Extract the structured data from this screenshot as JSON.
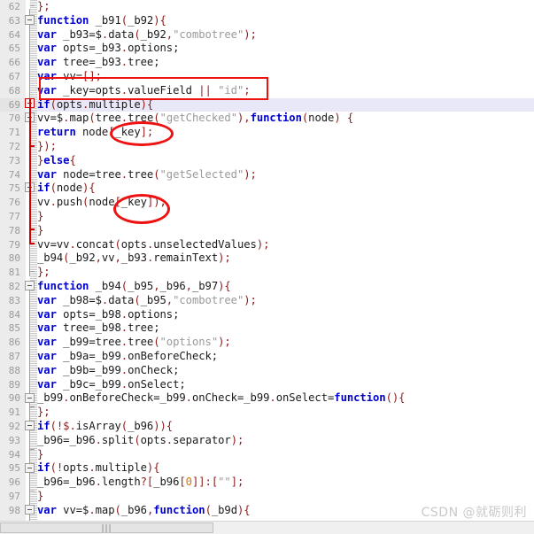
{
  "app": {
    "type": "code-editor",
    "language": "javascript",
    "watermark": "CSDN @就砺则利"
  },
  "colors": {
    "keyword": "#0000d0",
    "string": "#9a9a9a",
    "number": "#e07000",
    "punctuation": "#8b1a1a",
    "plain": "#1a1a1a",
    "gutter_bg": "#ececec",
    "line_number": "#9a9a9a",
    "current_line_bg": "#e8e8f8",
    "annotation": "#ee1111",
    "fold_marker": "#9a9a9a"
  },
  "editor": {
    "first_line_number": 62,
    "last_line_number": 98,
    "current_line": 69,
    "lines": [
      {
        "n": "62",
        "tokens": [
          {
            "t": "  ",
            "c": "plain"
          },
          {
            "t": "};",
            "c": "pun"
          }
        ]
      },
      {
        "n": "63",
        "tokens": [
          {
            "t": "function",
            "c": "kw"
          },
          {
            "t": " _b91",
            "c": "plain"
          },
          {
            "t": "(",
            "c": "pun"
          },
          {
            "t": "_b92",
            "c": "plain"
          },
          {
            "t": "){",
            "c": "pun"
          }
        ]
      },
      {
        "n": "64",
        "tokens": [
          {
            "t": " ",
            "c": "plain"
          },
          {
            "t": "var",
            "c": "kw"
          },
          {
            "t": " _b93=$",
            "c": "plain"
          },
          {
            "t": ".",
            "c": "pun"
          },
          {
            "t": "data",
            "c": "plain"
          },
          {
            "t": "(",
            "c": "pun"
          },
          {
            "t": "_b92",
            "c": "plain"
          },
          {
            "t": ",",
            "c": "pun"
          },
          {
            "t": "\"combotree\"",
            "c": "str"
          },
          {
            "t": ");",
            "c": "pun"
          }
        ]
      },
      {
        "n": "65",
        "tokens": [
          {
            "t": " ",
            "c": "plain"
          },
          {
            "t": "var",
            "c": "kw"
          },
          {
            "t": " opts=_b93",
            "c": "plain"
          },
          {
            "t": ".",
            "c": "pun"
          },
          {
            "t": "options;",
            "c": "plain"
          }
        ]
      },
      {
        "n": "66",
        "tokens": [
          {
            "t": " ",
            "c": "plain"
          },
          {
            "t": "var",
            "c": "kw"
          },
          {
            "t": " tree=_b93",
            "c": "plain"
          },
          {
            "t": ".",
            "c": "pun"
          },
          {
            "t": "tree;",
            "c": "plain"
          }
        ]
      },
      {
        "n": "67",
        "tokens": [
          {
            "t": " ",
            "c": "plain"
          },
          {
            "t": "var",
            "c": "kw"
          },
          {
            "t": " vv=",
            "c": "plain"
          },
          {
            "t": "[];",
            "c": "pun"
          }
        ]
      },
      {
        "n": "68",
        "tokens": [
          {
            "t": " ",
            "c": "plain"
          },
          {
            "t": "var",
            "c": "kw"
          },
          {
            "t": " _key=opts",
            "c": "plain"
          },
          {
            "t": ".",
            "c": "pun"
          },
          {
            "t": "valueField ",
            "c": "plain"
          },
          {
            "t": "||",
            "c": "pun"
          },
          {
            "t": " ",
            "c": "plain"
          },
          {
            "t": "\"id\"",
            "c": "str"
          },
          {
            "t": ";",
            "c": "pun"
          }
        ]
      },
      {
        "n": "69",
        "tokens": [
          {
            "t": "if",
            "c": "kw"
          },
          {
            "t": "(",
            "c": "pun"
          },
          {
            "t": "opts",
            "c": "plain"
          },
          {
            "t": ".",
            "c": "pun"
          },
          {
            "t": "multiple",
            "c": "plain"
          },
          {
            "t": "){",
            "c": "pun"
          }
        ]
      },
      {
        "n": "70",
        "tokens": [
          {
            "t": "vv=$",
            "c": "plain"
          },
          {
            "t": ".",
            "c": "pun"
          },
          {
            "t": "map",
            "c": "plain"
          },
          {
            "t": "(",
            "c": "pun"
          },
          {
            "t": "tree",
            "c": "plain"
          },
          {
            "t": ".",
            "c": "pun"
          },
          {
            "t": "tree",
            "c": "plain"
          },
          {
            "t": "(",
            "c": "pun"
          },
          {
            "t": "\"getChecked\"",
            "c": "str"
          },
          {
            "t": "),",
            "c": "pun"
          },
          {
            "t": "function",
            "c": "kw"
          },
          {
            "t": "(",
            "c": "pun"
          },
          {
            "t": "node",
            "c": "plain"
          },
          {
            "t": ") {",
            "c": "pun"
          }
        ]
      },
      {
        "n": "71",
        "tokens": [
          {
            "t": " ",
            "c": "plain"
          },
          {
            "t": "return",
            "c": "kw"
          },
          {
            "t": " node",
            "c": "plain"
          },
          {
            "t": "[",
            "c": "pun"
          },
          {
            "t": "_key",
            "c": "plain"
          },
          {
            "t": "];",
            "c": "pun"
          }
        ]
      },
      {
        "n": "72",
        "tokens": [
          {
            "t": "});",
            "c": "pun"
          }
        ]
      },
      {
        "n": "73",
        "tokens": [
          {
            "t": " ",
            "c": "plain"
          },
          {
            "t": "}",
            "c": "pun"
          },
          {
            "t": "else",
            "c": "kw"
          },
          {
            "t": "{",
            "c": "pun"
          }
        ]
      },
      {
        "n": "74",
        "tokens": [
          {
            "t": " ",
            "c": "plain"
          },
          {
            "t": "var",
            "c": "kw"
          },
          {
            "t": " node=tree",
            "c": "plain"
          },
          {
            "t": ".",
            "c": "pun"
          },
          {
            "t": "tree",
            "c": "plain"
          },
          {
            "t": "(",
            "c": "pun"
          },
          {
            "t": "\"getSelected\"",
            "c": "str"
          },
          {
            "t": ");",
            "c": "pun"
          }
        ]
      },
      {
        "n": "75",
        "tokens": [
          {
            "t": "if",
            "c": "kw"
          },
          {
            "t": "(",
            "c": "pun"
          },
          {
            "t": "node",
            "c": "plain"
          },
          {
            "t": "){",
            "c": "pun"
          }
        ]
      },
      {
        "n": "76",
        "tokens": [
          {
            "t": "vv",
            "c": "plain"
          },
          {
            "t": ".",
            "c": "pun"
          },
          {
            "t": "push",
            "c": "plain"
          },
          {
            "t": "(",
            "c": "pun"
          },
          {
            "t": "node",
            "c": "plain"
          },
          {
            "t": "[",
            "c": "pun"
          },
          {
            "t": "_key",
            "c": "plain"
          },
          {
            "t": "]);",
            "c": "pun"
          }
        ]
      },
      {
        "n": "77",
        "tokens": [
          {
            "t": "}",
            "c": "pun"
          }
        ]
      },
      {
        "n": "78",
        "tokens": [
          {
            "t": "}",
            "c": "pun"
          }
        ]
      },
      {
        "n": "79",
        "tokens": [
          {
            "t": " vv=vv",
            "c": "plain"
          },
          {
            "t": ".",
            "c": "pun"
          },
          {
            "t": "concat",
            "c": "plain"
          },
          {
            "t": "(",
            "c": "pun"
          },
          {
            "t": "opts",
            "c": "plain"
          },
          {
            "t": ".",
            "c": "pun"
          },
          {
            "t": "unselectedValues",
            "c": "plain"
          },
          {
            "t": ");",
            "c": "pun"
          }
        ]
      },
      {
        "n": "80",
        "tokens": [
          {
            "t": " _b94",
            "c": "plain"
          },
          {
            "t": "(",
            "c": "pun"
          },
          {
            "t": "_b92",
            "c": "plain"
          },
          {
            "t": ",",
            "c": "pun"
          },
          {
            "t": "vv",
            "c": "plain"
          },
          {
            "t": ",",
            "c": "pun"
          },
          {
            "t": "_b93",
            "c": "plain"
          },
          {
            "t": ".",
            "c": "pun"
          },
          {
            "t": "remainText",
            "c": "plain"
          },
          {
            "t": ");",
            "c": "pun"
          }
        ]
      },
      {
        "n": "81",
        "tokens": [
          {
            "t": "};",
            "c": "pun"
          }
        ]
      },
      {
        "n": "82",
        "tokens": [
          {
            "t": "function",
            "c": "kw"
          },
          {
            "t": " _b94",
            "c": "plain"
          },
          {
            "t": "(",
            "c": "pun"
          },
          {
            "t": "_b95",
            "c": "plain"
          },
          {
            "t": ",",
            "c": "pun"
          },
          {
            "t": "_b96",
            "c": "plain"
          },
          {
            "t": ",",
            "c": "pun"
          },
          {
            "t": "_b97",
            "c": "plain"
          },
          {
            "t": "){",
            "c": "pun"
          }
        ]
      },
      {
        "n": "83",
        "tokens": [
          {
            "t": " ",
            "c": "plain"
          },
          {
            "t": "var",
            "c": "kw"
          },
          {
            "t": " _b98=$",
            "c": "plain"
          },
          {
            "t": ".",
            "c": "pun"
          },
          {
            "t": "data",
            "c": "plain"
          },
          {
            "t": "(",
            "c": "pun"
          },
          {
            "t": "_b95",
            "c": "plain"
          },
          {
            "t": ",",
            "c": "pun"
          },
          {
            "t": "\"combotree\"",
            "c": "str"
          },
          {
            "t": ");",
            "c": "pun"
          }
        ]
      },
      {
        "n": "84",
        "tokens": [
          {
            "t": " ",
            "c": "plain"
          },
          {
            "t": "var",
            "c": "kw"
          },
          {
            "t": " opts=_b98",
            "c": "plain"
          },
          {
            "t": ".",
            "c": "pun"
          },
          {
            "t": "options;",
            "c": "plain"
          }
        ]
      },
      {
        "n": "85",
        "tokens": [
          {
            "t": " ",
            "c": "plain"
          },
          {
            "t": "var",
            "c": "kw"
          },
          {
            "t": " tree=_b98",
            "c": "plain"
          },
          {
            "t": ".",
            "c": "pun"
          },
          {
            "t": "tree;",
            "c": "plain"
          }
        ]
      },
      {
        "n": "86",
        "tokens": [
          {
            "t": " ",
            "c": "plain"
          },
          {
            "t": "var",
            "c": "kw"
          },
          {
            "t": " _b99=tree",
            "c": "plain"
          },
          {
            "t": ".",
            "c": "pun"
          },
          {
            "t": "tree",
            "c": "plain"
          },
          {
            "t": "(",
            "c": "pun"
          },
          {
            "t": "\"options\"",
            "c": "str"
          },
          {
            "t": ");",
            "c": "pun"
          }
        ]
      },
      {
        "n": "87",
        "tokens": [
          {
            "t": " ",
            "c": "plain"
          },
          {
            "t": "var",
            "c": "kw"
          },
          {
            "t": " _b9a=_b99",
            "c": "plain"
          },
          {
            "t": ".",
            "c": "pun"
          },
          {
            "t": "onBeforeCheck;",
            "c": "plain"
          }
        ]
      },
      {
        "n": "88",
        "tokens": [
          {
            "t": " ",
            "c": "plain"
          },
          {
            "t": "var",
            "c": "kw"
          },
          {
            "t": " _b9b=_b99",
            "c": "plain"
          },
          {
            "t": ".",
            "c": "pun"
          },
          {
            "t": "onCheck;",
            "c": "plain"
          }
        ]
      },
      {
        "n": "89",
        "tokens": [
          {
            "t": " ",
            "c": "plain"
          },
          {
            "t": "var",
            "c": "kw"
          },
          {
            "t": " _b9c=_b99",
            "c": "plain"
          },
          {
            "t": ".",
            "c": "pun"
          },
          {
            "t": "onSelect;",
            "c": "plain"
          }
        ]
      },
      {
        "n": "90",
        "tokens": [
          {
            "t": "_b99",
            "c": "plain"
          },
          {
            "t": ".",
            "c": "pun"
          },
          {
            "t": "onBeforeCheck=_b99",
            "c": "plain"
          },
          {
            "t": ".",
            "c": "pun"
          },
          {
            "t": "onCheck=_b99",
            "c": "plain"
          },
          {
            "t": ".",
            "c": "pun"
          },
          {
            "t": "onSelect=",
            "c": "plain"
          },
          {
            "t": "function",
            "c": "kw"
          },
          {
            "t": "(){",
            "c": "pun"
          }
        ]
      },
      {
        "n": "91",
        "tokens": [
          {
            "t": "};",
            "c": "pun"
          }
        ]
      },
      {
        "n": "92",
        "tokens": [
          {
            "t": "if",
            "c": "kw"
          },
          {
            "t": "(!$",
            "c": "pun"
          },
          {
            "t": ".",
            "c": "pun"
          },
          {
            "t": "isArray",
            "c": "plain"
          },
          {
            "t": "(",
            "c": "pun"
          },
          {
            "t": "_b96",
            "c": "plain"
          },
          {
            "t": ")){",
            "c": "pun"
          }
        ]
      },
      {
        "n": "93",
        "tokens": [
          {
            "t": " _b96=_b96",
            "c": "plain"
          },
          {
            "t": ".",
            "c": "pun"
          },
          {
            "t": "split",
            "c": "plain"
          },
          {
            "t": "(",
            "c": "pun"
          },
          {
            "t": "opts",
            "c": "plain"
          },
          {
            "t": ".",
            "c": "pun"
          },
          {
            "t": "separator",
            "c": "plain"
          },
          {
            "t": ");",
            "c": "pun"
          }
        ]
      },
      {
        "n": "94",
        "tokens": [
          {
            "t": "}",
            "c": "pun"
          }
        ]
      },
      {
        "n": "95",
        "tokens": [
          {
            "t": "if",
            "c": "kw"
          },
          {
            "t": "(!",
            "c": "pun"
          },
          {
            "t": "opts",
            "c": "plain"
          },
          {
            "t": ".",
            "c": "pun"
          },
          {
            "t": "multiple",
            "c": "plain"
          },
          {
            "t": "){",
            "c": "pun"
          }
        ]
      },
      {
        "n": "96",
        "tokens": [
          {
            "t": " _b96=_b96",
            "c": "plain"
          },
          {
            "t": ".",
            "c": "pun"
          },
          {
            "t": "length",
            "c": "plain"
          },
          {
            "t": "?[",
            "c": "pun"
          },
          {
            "t": "_b96",
            "c": "plain"
          },
          {
            "t": "[",
            "c": "pun"
          },
          {
            "t": "0",
            "c": "num"
          },
          {
            "t": "]]:[",
            "c": "pun"
          },
          {
            "t": "\"\"",
            "c": "str"
          },
          {
            "t": "];",
            "c": "pun"
          }
        ]
      },
      {
        "n": "97",
        "tokens": [
          {
            "t": "}",
            "c": "pun"
          }
        ]
      },
      {
        "n": "98",
        "tokens": [
          {
            "t": "var",
            "c": "kw"
          },
          {
            "t": " vv=$",
            "c": "plain"
          },
          {
            "t": ".",
            "c": "pun"
          },
          {
            "t": "map",
            "c": "plain"
          },
          {
            "t": "(",
            "c": "pun"
          },
          {
            "t": "_b96",
            "c": "plain"
          },
          {
            "t": ",",
            "c": "pun"
          },
          {
            "t": "function",
            "c": "kw"
          },
          {
            "t": "(",
            "c": "pun"
          },
          {
            "t": "_b9d",
            "c": "plain"
          },
          {
            "t": "){",
            "c": "pun"
          }
        ]
      }
    ]
  },
  "annotations": [
    {
      "kind": "rectangle",
      "target_line": "68",
      "target_text": "var _key=opts.valueField || \"id\";"
    },
    {
      "kind": "ellipse",
      "target_line": "71",
      "target_text": "[_key];"
    },
    {
      "kind": "ellipse",
      "target_line": "76",
      "target_text": "[_key])"
    }
  ],
  "scrollbar": {
    "orientation": "horizontal",
    "grip": "|||"
  }
}
